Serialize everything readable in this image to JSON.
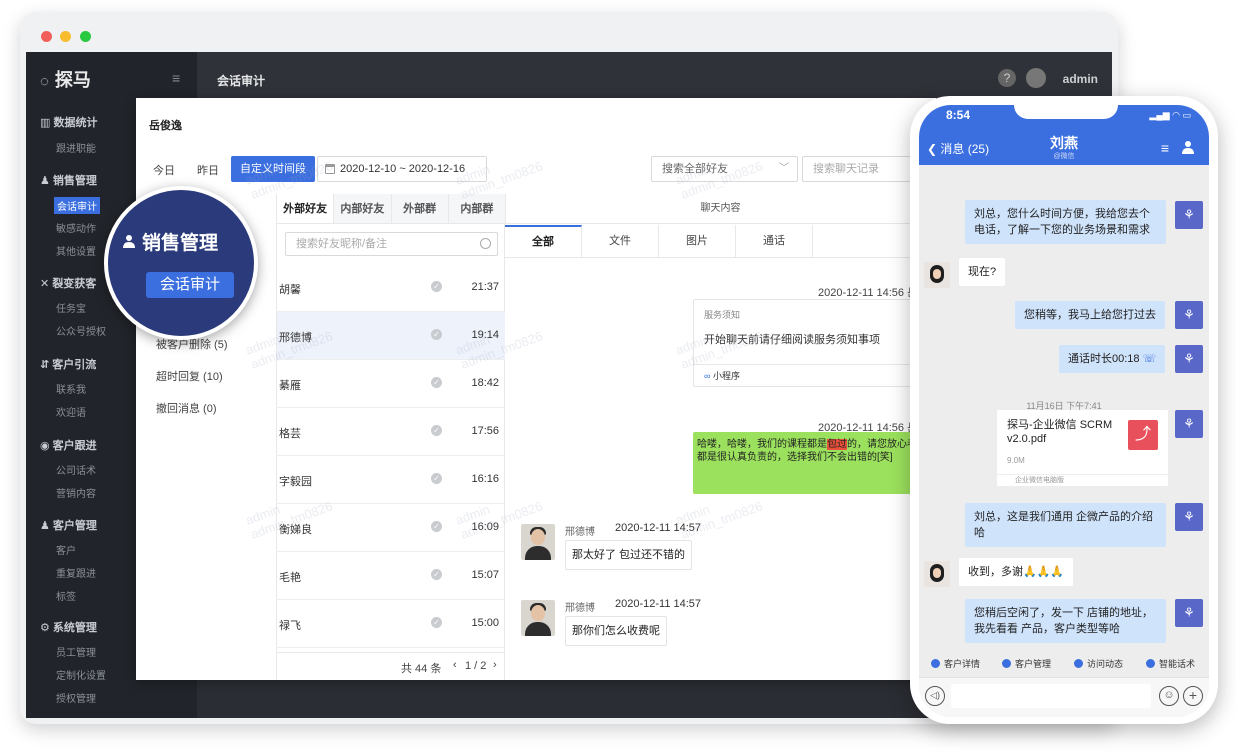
{
  "desktop": {
    "logo": "探马",
    "topbar": {
      "title": "会话审计",
      "user": "admin"
    },
    "sidebar": [
      {
        "label": "数据统计",
        "subs": [
          "跟进职能"
        ]
      },
      {
        "label": "销售管理",
        "subs": [
          "会话审计",
          "敏感动作",
          "其他设置"
        ]
      },
      {
        "label": "裂变获客",
        "subs": [
          "任务宝",
          "公众号授权"
        ]
      },
      {
        "label": "客户引流",
        "subs": [
          "联系我",
          "欢迎语"
        ]
      },
      {
        "label": "客户跟进",
        "subs": [
          "公司话术",
          "营销内容"
        ]
      },
      {
        "label": "客户管理",
        "subs": [
          "客户",
          "重复跟进",
          "标签"
        ]
      },
      {
        "label": "系统管理",
        "subs": [
          "员工管理",
          "定制化设置",
          "授权管理"
        ]
      }
    ],
    "panel": {
      "name": "岳俊逸",
      "quick_today": "今日",
      "quick_yesterday": "昨日",
      "custom_range": "自定义时间段",
      "date_range": "2020-12-10 ~ 2020-12-16",
      "friend_select": "搜索全部好友",
      "record_search": "搜索聊天记录",
      "stats": [
        "被客户删除 (5)",
        "超时回复 (10)",
        "撤回消息 (0)"
      ],
      "friend_tabs": [
        "外部好友",
        "内部好友",
        "外部群",
        "内部群"
      ],
      "friend_search": "搜索好友昵称/备注",
      "friends": [
        {
          "name": "胡馨",
          "time": "21:37"
        },
        {
          "name": "邢德博",
          "time": "19:14"
        },
        {
          "name": "綦雁",
          "time": "18:42"
        },
        {
          "name": "格芸",
          "time": "17:56"
        },
        {
          "name": "字毅园",
          "time": "16:16"
        },
        {
          "name": "衡娣良",
          "time": "16:09"
        },
        {
          "name": "毛艳",
          "time": "15:07"
        },
        {
          "name": "禄飞",
          "time": "15:00"
        }
      ],
      "pager_total": "共 44 条",
      "pager_page": "1 / 2",
      "chat_header": "聊天内容",
      "chat_tabs": [
        "全部",
        "文件",
        "图片",
        "通话"
      ],
      "msg1_time": "2020-12-11 14:56 岳",
      "card_tag": "服务须知",
      "card_text": "开始聊天前请仔细阅读服务须知事项",
      "card_foot": "小程序",
      "msg2_time": "2020-12-11 14:56 岳",
      "green_pre": "哈喽，哈喽，我们的课程都是",
      "green_hl": "包过",
      "green_post": "的，请您放心老师们都是很认真负责的，选择我们不会出错的[笑]",
      "msg3_sender": "邢德博",
      "msg3_time": "2020-12-11 14:57",
      "msg3_text": "那太好了 包过还不错的",
      "msg4_sender": "邢德博",
      "msg4_time": "2020-12-11 14:57",
      "msg4_text": "那你们怎么收费呢"
    },
    "watermark": [
      "admin",
      "admin_tm0826"
    ],
    "highlight": {
      "title": "销售管理",
      "button": "会话审计"
    }
  },
  "phone": {
    "clock": "8:54",
    "back_label": "消息 (25)",
    "title": "刘燕",
    "subtitle": "@微信",
    "messages": [
      "刘总，您什么时间方便，我给您去个电话，了解一下您的业务场景和需求",
      "现在?",
      "您稍等，我马上给您打过去",
      "通话时长00:18",
      "刘总，这是我们通用 企微产品的介绍哈",
      "收到，多谢🙏🙏🙏",
      "您稍后空闲了，发一下 店铺的地址，我先看看 产品，客户类型等哈"
    ],
    "date_divider": "11月16日 下午7:41",
    "file_name": "探马-企业微信 SCRM v2.0.pdf",
    "file_size": "9.0M",
    "file_source": "企业微信电脑版",
    "quick_actions": [
      "客户详情",
      "客户管理",
      "访问动态",
      "智能话术"
    ]
  }
}
